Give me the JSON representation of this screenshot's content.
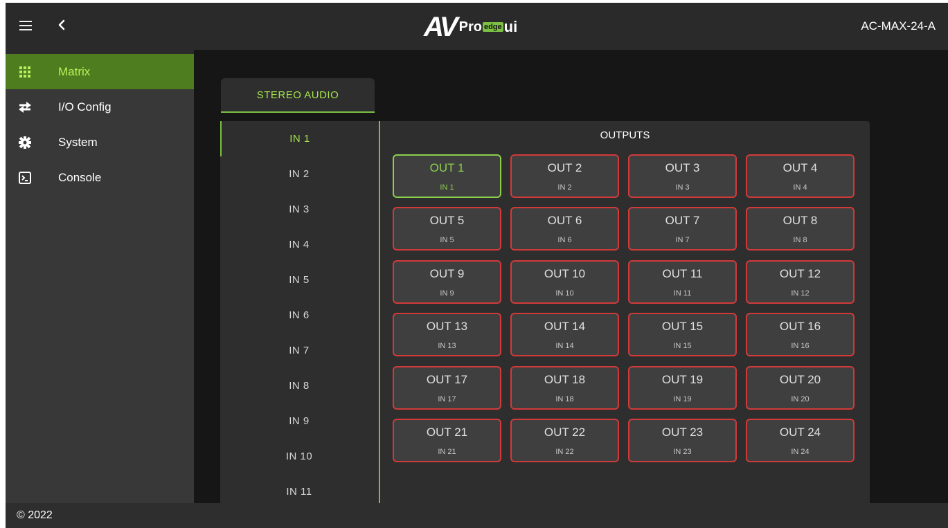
{
  "header": {
    "logo_av": "AV",
    "logo_pro": "Pro",
    "logo_edge": "edge",
    "logo_ui": "ui",
    "device": "AC-MAX-24-A"
  },
  "sidebar": {
    "items": [
      {
        "label": "Matrix",
        "icon": "grid-icon",
        "active": true
      },
      {
        "label": "I/O Config",
        "icon": "swap-arrows-icon",
        "active": false
      },
      {
        "label": "System",
        "icon": "gear-icon",
        "active": false
      },
      {
        "label": "Console",
        "icon": "terminal-icon",
        "active": false
      }
    ]
  },
  "tab": {
    "label": "STEREO AUDIO"
  },
  "inputs": [
    "IN 1",
    "IN 2",
    "IN 3",
    "IN 4",
    "IN 5",
    "IN 6",
    "IN 7",
    "IN 8",
    "IN 9",
    "IN 10",
    "IN 11"
  ],
  "selected_input": "IN 1",
  "outputs_title": "OUTPUTS",
  "outputs": [
    {
      "name": "OUT 1",
      "source": "IN 1"
    },
    {
      "name": "OUT 2",
      "source": "IN 2"
    },
    {
      "name": "OUT 3",
      "source": "IN 3"
    },
    {
      "name": "OUT 4",
      "source": "IN 4"
    },
    {
      "name": "OUT 5",
      "source": "IN 5"
    },
    {
      "name": "OUT 6",
      "source": "IN 6"
    },
    {
      "name": "OUT 7",
      "source": "IN 7"
    },
    {
      "name": "OUT 8",
      "source": "IN 8"
    },
    {
      "name": "OUT 9",
      "source": "IN 9"
    },
    {
      "name": "OUT 10",
      "source": "IN 10"
    },
    {
      "name": "OUT 11",
      "source": "IN 11"
    },
    {
      "name": "OUT 12",
      "source": "IN 12"
    },
    {
      "name": "OUT 13",
      "source": "IN 13"
    },
    {
      "name": "OUT 14",
      "source": "IN 14"
    },
    {
      "name": "OUT 15",
      "source": "IN 15"
    },
    {
      "name": "OUT 16",
      "source": "IN 16"
    },
    {
      "name": "OUT 17",
      "source": "IN 17"
    },
    {
      "name": "OUT 18",
      "source": "IN 18"
    },
    {
      "name": "OUT 19",
      "source": "IN 19"
    },
    {
      "name": "OUT 20",
      "source": "IN 20"
    },
    {
      "name": "OUT 21",
      "source": "IN 21"
    },
    {
      "name": "OUT 22",
      "source": "IN 22"
    },
    {
      "name": "OUT 23",
      "source": "IN 23"
    },
    {
      "name": "OUT 24",
      "source": "IN 24"
    }
  ],
  "footer": {
    "copyright": "© 2022"
  },
  "colors": {
    "accent_green": "#7bc043",
    "active_bg": "#4e7d1f",
    "unselected_border": "#d23a3a"
  }
}
